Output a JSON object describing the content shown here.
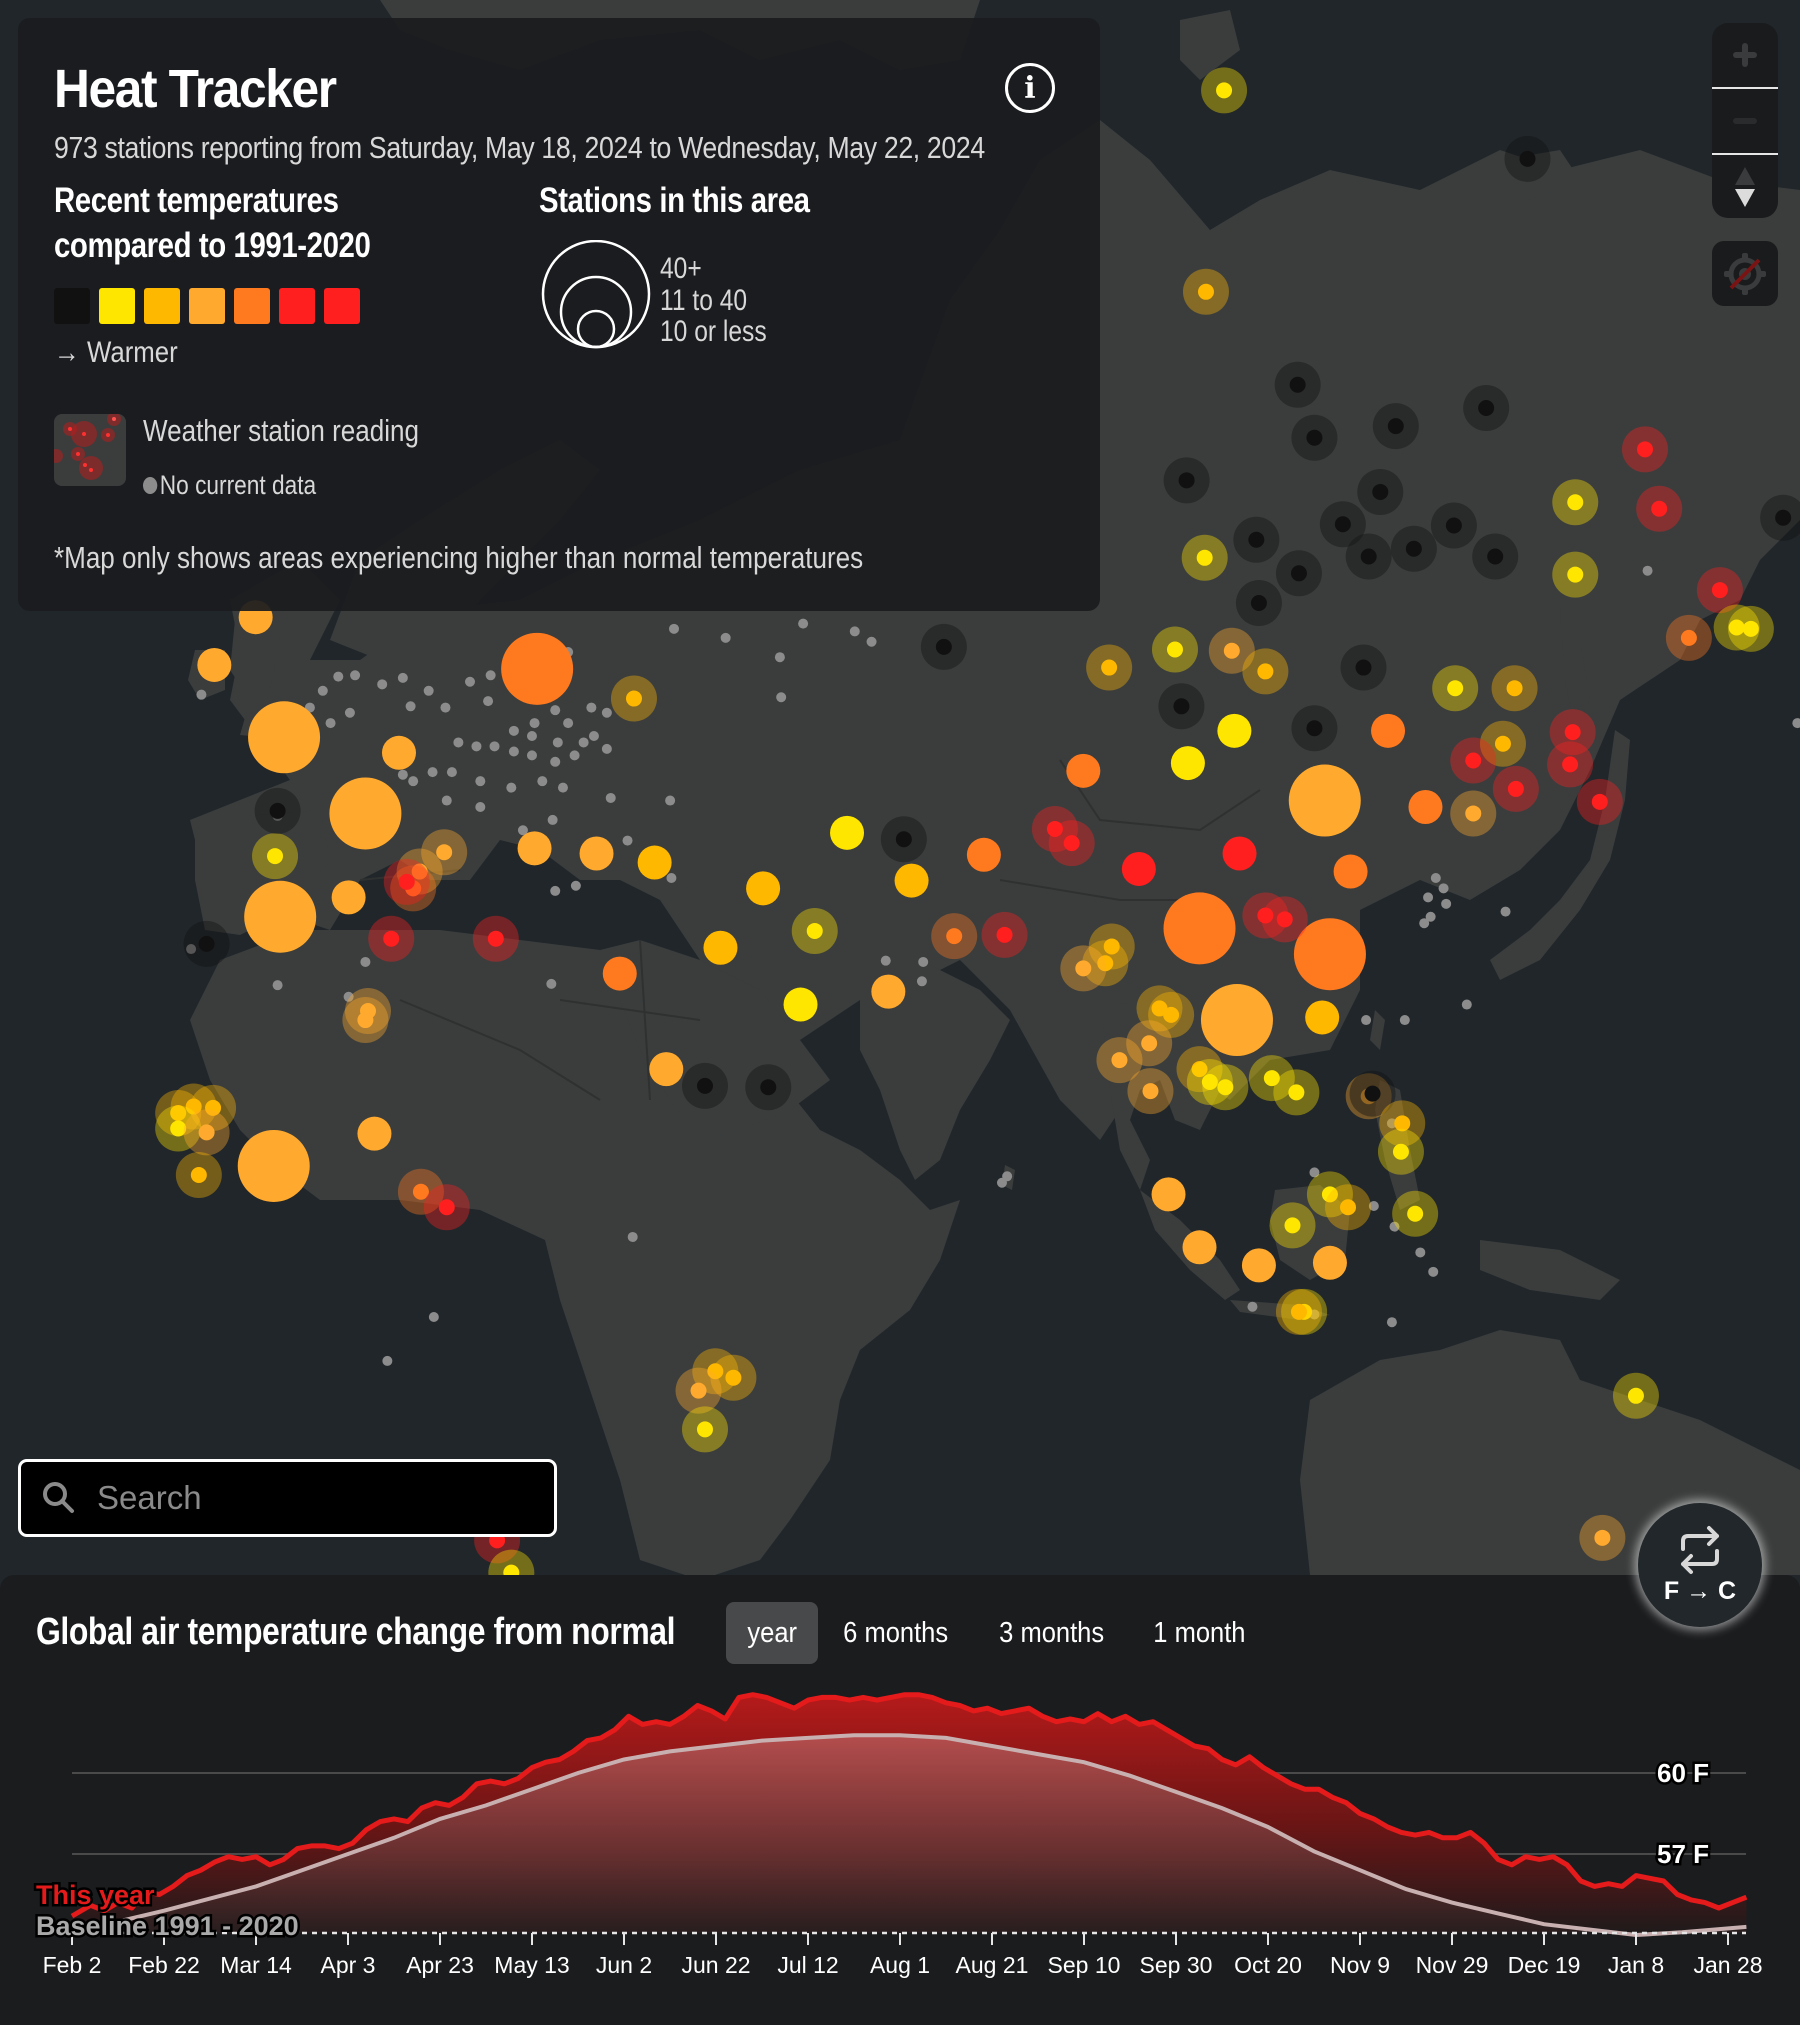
{
  "header": {
    "title": "Heat Tracker",
    "subtitle": "973 stations reporting from Saturday, May 18, 2024 to Wednesday, May 22, 2024",
    "info_icon": "info-icon"
  },
  "legend": {
    "temp_heading_line1": "Recent temperatures",
    "temp_heading_line2": "compared to 1991-2020",
    "temp_scale_colors": [
      "#111111",
      "#ffe600",
      "#ffb800",
      "#ffaa2e",
      "#ff7a1f",
      "#ff1f1f",
      "#ff1f1f"
    ],
    "warmer_label": "→ Warmer",
    "stations_heading": "Stations in this area",
    "size_labels": [
      "40+",
      "11 to 40",
      "10 or less"
    ],
    "station_reading_label": "Weather station reading",
    "no_data_label": "No current data",
    "footnote": "*Map only shows areas experiencing higher than normal temperatures"
  },
  "map_controls": {
    "zoom_in": "plus-icon",
    "zoom_out": "minus-icon",
    "compass": "compass-icon",
    "locate": "locate-disabled-icon"
  },
  "search": {
    "placeholder": "Search",
    "value": ""
  },
  "unit_toggle": {
    "label": "F → C",
    "icon": "swap-arrows-icon"
  },
  "chart_panel": {
    "title": "Global air temperature change from normal",
    "tabs": [
      {
        "label": "year",
        "active": true
      },
      {
        "label": "6 months",
        "active": false
      },
      {
        "label": "3 months",
        "active": false
      },
      {
        "label": "1 month",
        "active": false
      }
    ]
  },
  "colors": {
    "this_year": "#e51b1b",
    "baseline": "#c8b0b0",
    "land": "#3b3d3d",
    "ocean": "#20262a"
  },
  "chart_data": {
    "type": "area",
    "title": "Global air temperature change from normal",
    "xlabel": "",
    "ylabel": "",
    "x_tick_labels": [
      "Feb 2",
      "Feb 22",
      "Mar 14",
      "Apr 3",
      "Apr 23",
      "May 13",
      "Jun 2",
      "Jun 22",
      "Jul 12",
      "Aug 1",
      "Aug 21",
      "Sep 10",
      "Sep 30",
      "Oct 20",
      "Nov 9",
      "Nov 29",
      "Dec 19",
      "Jan 8",
      "Jan 28"
    ],
    "x_tick_days": [
      0,
      20,
      40,
      60,
      80,
      100,
      120,
      140,
      160,
      180,
      200,
      220,
      240,
      260,
      280,
      300,
      320,
      340,
      360
    ],
    "y_gridlines": [
      60,
      57
    ],
    "y_tick_labels": [
      "60 F",
      "57 F"
    ],
    "ylim": [
      54,
      63.5
    ],
    "xlim_days": [
      0,
      364
    ],
    "grid": true,
    "legend": "bottom-left",
    "series": [
      {
        "name": "This year",
        "x_days": [
          0,
          4,
          7,
          10,
          13,
          16,
          19,
          22,
          25,
          28,
          31,
          34,
          37,
          40,
          43,
          46,
          49,
          52,
          55,
          58,
          61,
          64,
          67,
          70,
          73,
          76,
          79,
          82,
          85,
          88,
          91,
          94,
          97,
          100,
          103,
          106,
          109,
          112,
          115,
          118,
          121,
          124,
          127,
          130,
          133,
          136,
          139,
          142,
          145,
          148,
          151,
          154,
          157,
          160,
          163,
          166,
          169,
          172,
          175,
          178,
          181,
          184,
          187,
          190,
          193,
          196,
          199,
          202,
          205,
          208,
          211,
          214,
          217,
          220,
          223,
          226,
          229,
          232,
          235,
          238,
          241,
          244,
          247,
          250,
          253,
          256,
          259,
          262,
          265,
          268,
          271,
          274,
          277,
          280,
          283,
          286,
          289,
          292,
          295,
          298,
          301,
          304,
          307,
          310,
          313,
          316,
          319,
          322,
          325,
          328,
          331,
          334,
          337,
          340,
          343,
          346,
          349,
          352,
          355,
          358,
          361,
          364
        ],
        "values": [
          54.7,
          55.1,
          54.9,
          55.2,
          55.0,
          55.6,
          55.5,
          55.8,
          56.2,
          56.4,
          56.7,
          56.9,
          56.8,
          56.9,
          56.6,
          56.8,
          57.2,
          57.3,
          57.3,
          57.2,
          57.4,
          57.9,
          58.2,
          58.3,
          58.2,
          58.7,
          58.9,
          58.8,
          59.1,
          59.6,
          59.7,
          59.6,
          59.8,
          60.2,
          60.4,
          60.5,
          60.8,
          61.2,
          61.3,
          61.6,
          62.1,
          61.8,
          61.9,
          61.8,
          62.1,
          62.5,
          62.3,
          62.0,
          62.8,
          62.9,
          62.8,
          62.6,
          62.4,
          62.7,
          62.8,
          62.8,
          62.7,
          62.8,
          62.7,
          62.8,
          62.9,
          62.9,
          62.8,
          62.6,
          62.5,
          62.3,
          62.4,
          62.2,
          62.3,
          62.4,
          62.1,
          61.9,
          62.0,
          61.9,
          62.2,
          61.9,
          62.1,
          61.8,
          61.9,
          61.6,
          61.3,
          61.0,
          60.9,
          60.5,
          60.3,
          60.6,
          60.2,
          59.9,
          59.6,
          59.4,
          59.4,
          59.1,
          58.9,
          58.5,
          58.3,
          58.0,
          57.8,
          57.7,
          57.8,
          57.6,
          57.6,
          57.8,
          57.4,
          56.8,
          56.6,
          56.9,
          56.8,
          56.9,
          56.6,
          56.0,
          55.8,
          55.9,
          55.8,
          56.2,
          56.1,
          56.0,
          55.5,
          55.3,
          55.2,
          55.0,
          55.2,
          55.4,
          55.6,
          55.7,
          55.9,
          56.1
        ]
      },
      {
        "name": "Baseline 1991 - 2020",
        "x_days": [
          0,
          20,
          40,
          50,
          60,
          70,
          80,
          90,
          100,
          110,
          120,
          130,
          140,
          150,
          160,
          170,
          180,
          190,
          200,
          210,
          220,
          230,
          240,
          250,
          260,
          270,
          280,
          290,
          300,
          310,
          320,
          330,
          340,
          350,
          364
        ],
        "values": [
          54.1,
          54.9,
          55.8,
          56.4,
          57.0,
          57.6,
          58.3,
          58.8,
          59.4,
          60.0,
          60.5,
          60.8,
          61.0,
          61.2,
          61.3,
          61.4,
          61.4,
          61.3,
          61.0,
          60.7,
          60.4,
          59.9,
          59.3,
          58.7,
          58.0,
          57.1,
          56.4,
          55.7,
          55.2,
          54.8,
          54.4,
          54.2,
          54.0,
          54.1,
          54.3
        ]
      }
    ],
    "annotations": [
      "This year",
      "Baseline 1991 - 2020"
    ]
  }
}
